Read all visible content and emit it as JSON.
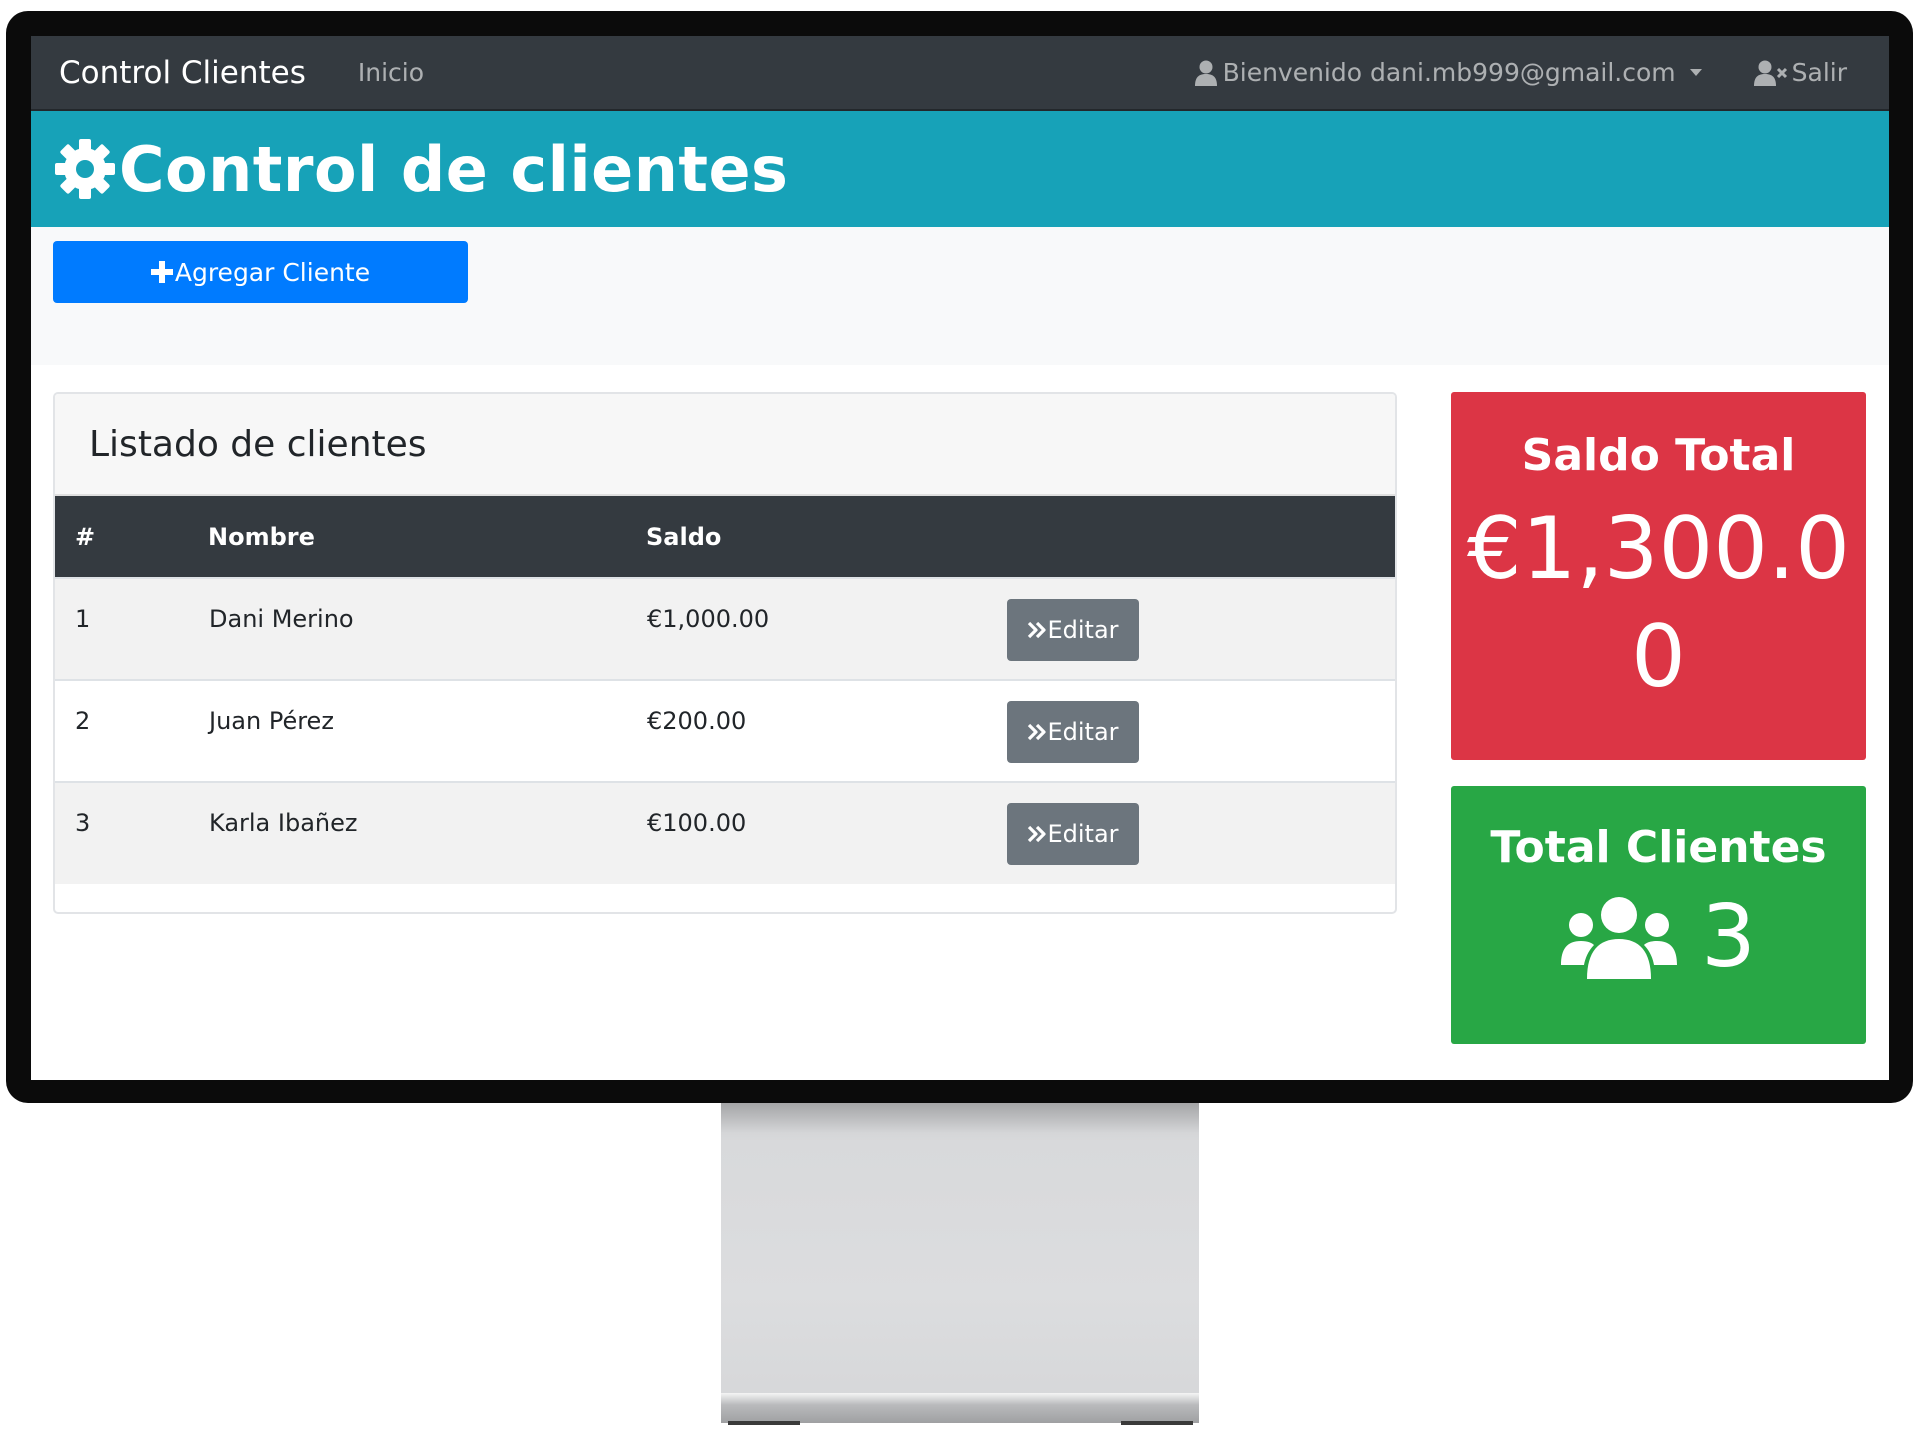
{
  "navbar": {
    "brand": "Control Clientes",
    "home_link": "Inicio",
    "welcome": "Bienvenido dani.mb999@gmail.com",
    "logout": "Salir"
  },
  "header": {
    "title": "Control de clientes"
  },
  "actions": {
    "add_label": "Agregar Cliente"
  },
  "client_list": {
    "title": "Listado de clientes",
    "columns": [
      "#",
      "Nombre",
      "Saldo",
      ""
    ],
    "rows": [
      {
        "num": "1",
        "name": "Dani Merino",
        "balance": "€1,000.00",
        "action": "Editar"
      },
      {
        "num": "2",
        "name": "Juan Pérez",
        "balance": "€200.00",
        "action": "Editar"
      },
      {
        "num": "3",
        "name": "Karla Ibañez",
        "balance": "€100.00",
        "action": "Editar"
      }
    ]
  },
  "summary": {
    "balance_title": "Saldo Total",
    "balance_value": "€1,300.00",
    "clients_title": "Total Clientes",
    "clients_count": "3"
  },
  "icons": {
    "user": "user-icon",
    "user-x": "user-times-icon",
    "gear": "gear-icon",
    "plus": "plus-icon",
    "double-chevron": "angle-double-right-icon",
    "users": "users-icon"
  },
  "colors": {
    "navbar": "#343a40",
    "header": "#17a2b8",
    "primary": "#007bff",
    "secondary": "#6c757d",
    "danger": "#dc3545",
    "success": "#28a745"
  }
}
